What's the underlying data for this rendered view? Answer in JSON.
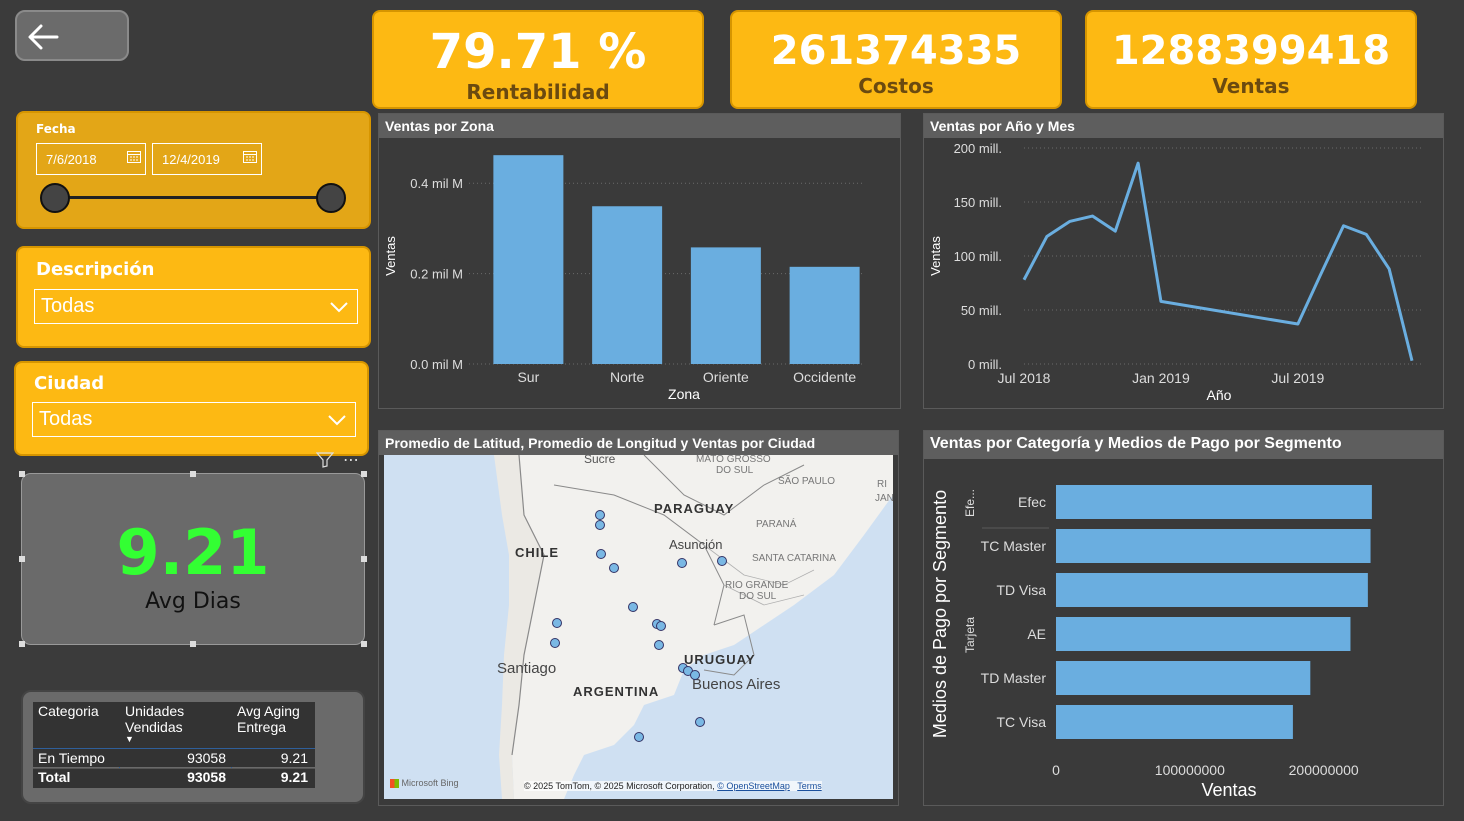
{
  "kpis": {
    "rentabilidad": {
      "value": "79.71 %",
      "label": "Rentabilidad"
    },
    "costos": {
      "value": "261374335",
      "label": "Costos"
    },
    "ventas": {
      "value": "1288399418",
      "label": "Ventas"
    }
  },
  "fecha_slicer": {
    "title": "Fecha",
    "start": "7/6/2018",
    "end": "12/4/2019"
  },
  "descripcion_slicer": {
    "title": "Descripción",
    "selected": "Todas"
  },
  "ciudad_slicer": {
    "title": "Ciudad",
    "selected": "Todas"
  },
  "avg_card": {
    "value": "9.21",
    "label": "Avg Dias"
  },
  "table": {
    "headers": [
      "Categoria",
      "Unidades Vendidas",
      "Avg Aging Entrega"
    ],
    "header_col1_line1": "Unidades",
    "header_col1_line2": "Vendidas",
    "header_col2_line1": "Avg Aging",
    "header_col2_line2": "Entrega",
    "rows": [
      {
        "categoria": "En Tiempo",
        "unidades": "93058",
        "avg": "9.21"
      }
    ],
    "total": {
      "categoria": "Total",
      "unidades": "93058",
      "avg": "9.21"
    }
  },
  "map": {
    "title": "Promedio de Latitud, Promedio de Longitud y Ventas por Ciudad",
    "labels": {
      "sucre": "Sucre",
      "mato_grosso": "MATO GROSSO",
      "mato_grosso_2": "DO SUL",
      "sao_paulo": "SÃO PAULO",
      "ri": "RI",
      "jan": "JAN",
      "paraguay": "PARAGUAY",
      "parana": "PARANÁ",
      "chile": "CHILE",
      "asuncion": "Asunción",
      "santa_catarina": "SANTA CATARINA",
      "rio_grande": "RIO GRANDE",
      "rio_grande_2": "DO SUL",
      "uruguay": "URUGUAY",
      "santiago": "Santiago",
      "argentina": "ARGENTINA",
      "buenos_aires": "Buenos Aires"
    },
    "bing": "Microsoft Bing",
    "copyright": "© 2025 TomTom, © 2025 Microsoft Corporation,",
    "osm": "© OpenStreetMap",
    "terms": "Terms"
  },
  "chart_data": [
    {
      "type": "bar",
      "title": "Ventas por Zona",
      "xlabel": "Zona",
      "ylabel": "Ventas",
      "categories": [
        "Sur",
        "Norte",
        "Oriente",
        "Occidente"
      ],
      "values": [
        462000000,
        349000000,
        258000000,
        215000000
      ],
      "ylim": [
        0,
        500000000
      ],
      "yticks": [
        0,
        200000000,
        400000000
      ],
      "ytick_labels": [
        "0.0 mil M",
        "0.2 mil M",
        "0.4 mil M"
      ],
      "color": "#6aaee0"
    },
    {
      "type": "line",
      "title": "Ventas por Año y Mes",
      "xlabel": "Año",
      "ylabel": "Ventas",
      "x": [
        "2018-07",
        "2018-08",
        "2018-09",
        "2018-10",
        "2018-11",
        "2018-12",
        "2019-01",
        "2019-07",
        "2019-08",
        "2019-09",
        "2019-10",
        "2019-11"
      ],
      "x_index": [
        0,
        1,
        2,
        3,
        4,
        5,
        6,
        12,
        13,
        14,
        15,
        16
      ],
      "values": [
        78000000,
        118000000,
        132000000,
        137000000,
        123000000,
        186000000,
        58000000,
        37000000,
        83000000,
        128000000,
        120000000,
        88000000
      ],
      "extra_last": {
        "x": "2019-12",
        "value": 3000000
      },
      "ylim": [
        0,
        200000000
      ],
      "yticks": [
        0,
        50000000,
        100000000,
        150000000,
        200000000
      ],
      "ytick_labels": [
        "0 mill.",
        "50 mill.",
        "100 mill.",
        "150 mill.",
        "200 mill."
      ],
      "xtick_labels": [
        "Jul 2018",
        "Jan 2019",
        "Jul 2019"
      ],
      "color": "#6aaee0"
    },
    {
      "type": "bar",
      "orientation": "horizontal",
      "title": "Ventas por Categoría y Medios de Pago por Segmento",
      "xlabel": "Ventas",
      "ylabel": "Medios de Pago por Segmento",
      "groups": [
        {
          "name": "Efe...",
          "categories": [
            "Efec"
          ]
        },
        {
          "name": "Tarjeta",
          "categories": [
            "TC Master",
            "TD Visa",
            "AE",
            "TD Master",
            "TC Visa"
          ]
        }
      ],
      "categories": [
        "Efec",
        "TC Master",
        "TD Visa",
        "AE",
        "TD Master",
        "TC Visa"
      ],
      "values": [
        236000000,
        235000000,
        233000000,
        220000000,
        190000000,
        177000000
      ],
      "xlim": [
        0,
        260000000
      ],
      "xticks": [
        0,
        100000000,
        200000000
      ],
      "xtick_labels": [
        "0",
        "100000000",
        "200000000"
      ],
      "color": "#6aaee0"
    }
  ]
}
